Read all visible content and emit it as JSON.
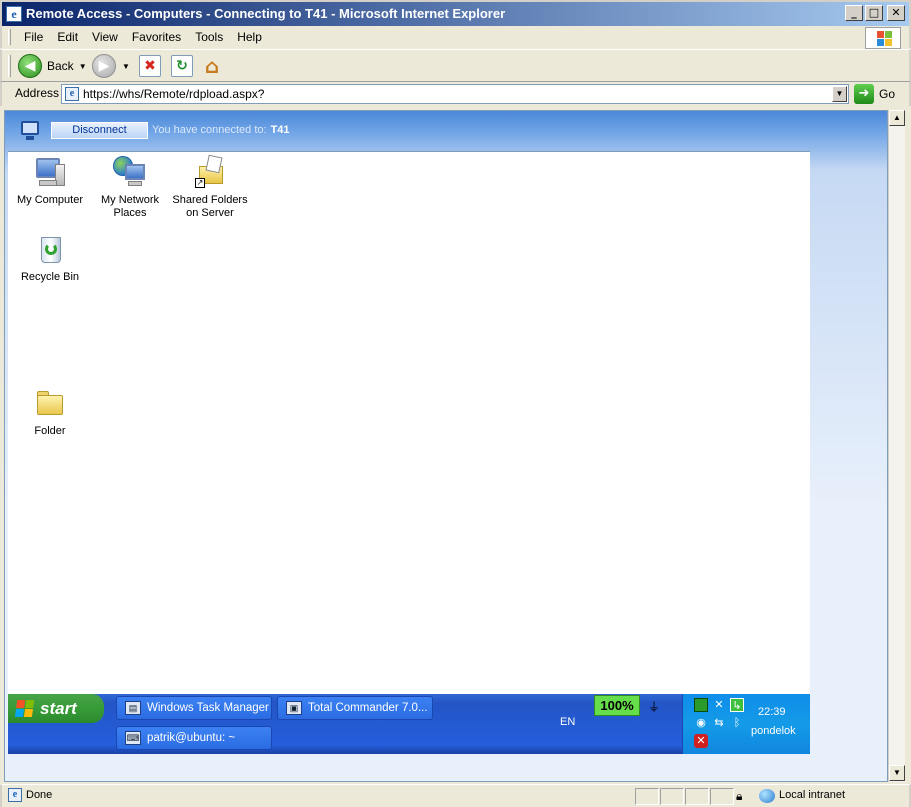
{
  "window": {
    "title": "Remote Access - Computers - Connecting to T41 - Microsoft Internet Explorer",
    "minimize": "_",
    "maximize": "□",
    "close": "✕"
  },
  "menu": {
    "items": [
      "File",
      "Edit",
      "View",
      "Favorites",
      "Tools",
      "Help"
    ]
  },
  "toolbar": {
    "back_label": "Back"
  },
  "address": {
    "label": "Address",
    "url": "https://whs/Remote/rdpload.aspx?",
    "go_label": "Go"
  },
  "rdp": {
    "disconnect_label": "Disconnect",
    "connected_text": "You have connected to:",
    "host": "T41"
  },
  "desktop": {
    "icons": [
      {
        "label": "My Computer",
        "icon": "my-computer-icon"
      },
      {
        "label": "My Network Places",
        "icon": "network-places-icon"
      },
      {
        "label": "Shared Folders on Server",
        "icon": "shared-folders-icon"
      },
      {
        "label": "Recycle Bin",
        "icon": "recycle-bin-icon"
      },
      {
        "label": "Folder",
        "icon": "folder-icon"
      }
    ]
  },
  "taskbar": {
    "start_label": "start",
    "tasks": [
      {
        "label": "Windows Task Manager"
      },
      {
        "label": "Total Commander 7.0..."
      },
      {
        "label": "patrik@ubuntu: ~"
      }
    ],
    "language": "EN",
    "battery": "100%",
    "clock": "22:39",
    "day": "pondelok"
  },
  "status": {
    "text": "Done",
    "zone": "Local intranet"
  },
  "colors": {
    "title_bar_start": "#0a246a",
    "taskbar_blue": "#245edb",
    "start_green": "#379b37",
    "tray_blue": "#149be8",
    "battery_green": "#66dd4a"
  }
}
